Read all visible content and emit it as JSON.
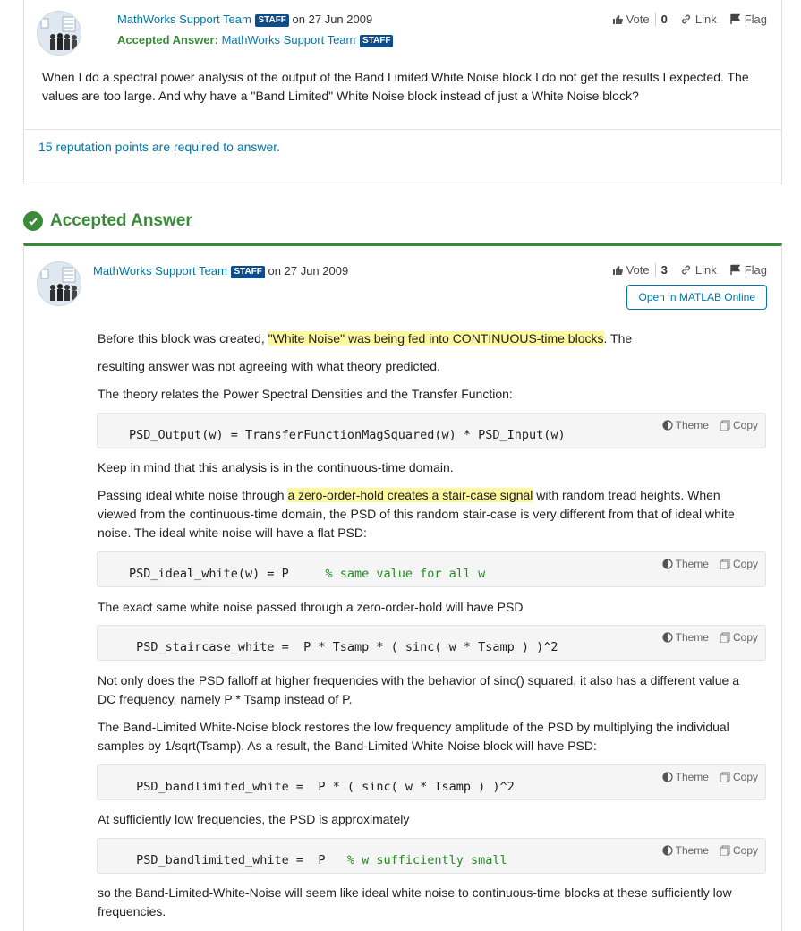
{
  "question": {
    "author": "MathWorks Support Team",
    "staff_badge": "STAFF",
    "date": "on 27 Jun 2009",
    "accepted_label": "Accepted Answer:",
    "accepted_author": "MathWorks Support Team",
    "accepted_badge": "STAFF",
    "vote_label": "Vote",
    "vote_count": "0",
    "link_label": "Link",
    "flag_label": "Flag",
    "body": "When I do a spectral power analysis of the output of the Band Limited White Noise block I do not get the results I expected. The values are too large. And why have a \"Band Limited\" White Noise block instead of just a White Noise block?",
    "reputation_note": "15 reputation points are required to answer."
  },
  "accepted_section": {
    "heading": "Accepted Answer"
  },
  "answer": {
    "author": "MathWorks Support Team",
    "staff_badge": "STAFF",
    "date": "on 27 Jun 2009",
    "vote_label": "Vote",
    "vote_count": "3",
    "link_label": "Link",
    "flag_label": "Flag",
    "open_matlab": "Open in MATLAB Online",
    "p1_before": "Before this block was created, ",
    "p1_highlight": "\"White Noise\" was being fed into CONTINUOUS-time blocks",
    "p1_after": ". The",
    "p2": "resulting answer was not agreeing with what theory predicted.",
    "p3": "The theory relates the Power Spectral Densities and the Transfer Function:",
    "code1": "PSD_Output(w) = TransferFunctionMagSquared(w) * PSD_Input(w)",
    "p4": "Keep in mind that this analysis is in the continuous-time domain.",
    "p5_before": "Passing ideal white noise through ",
    "p5_highlight": "a zero-order-hold creates a stair-case signal",
    "p5_after": " with random tread heights. When viewed from the continuous-time domain, the PSD of this random stair-case is very different from that of ideal white noise. The ideal white noise will have a flat PSD:",
    "code2_code": "PSD_ideal_white(w) = P     ",
    "code2_comment": "% same value for all w",
    "p6": "The exact same white noise passed through a zero-order-hold will have PSD",
    "code3": " PSD_staircase_white =  P * Tsamp * ( sinc( w * Tsamp ) )^2",
    "p7": "Not only does the PSD falloff at higher frequencies with the behavior of sinc() squared, it also has a different value a DC frequency, namely P * Tsamp instead of P.",
    "p8": "The Band-Limited White-Noise block restores the low frequency amplitude of the PSD by multiplying the individual samples by 1/sqrt(Tsamp). As a result, the Band-Limited White-Noise block will have PSD:",
    "code4": " PSD_bandlimited_white =  P * ( sinc( w * Tsamp ) )^2",
    "p9": "At sufficiently low frequencies, the PSD is approximately",
    "code5_code": " PSD_bandlimited_white =  P   ",
    "code5_comment": "% w sufficiently small",
    "p10": "so the Band-Limited-White-Noise will seem like ideal white noise to continuous-time blocks at these sufficiently low frequencies."
  },
  "code_tools": {
    "theme": "Theme",
    "copy": "Copy"
  },
  "colors": {
    "accent_green": "#3a8a3a",
    "link_blue": "#0076a8",
    "staff_badge": "#0e4d8a",
    "highlight": "#fdf7a0"
  }
}
